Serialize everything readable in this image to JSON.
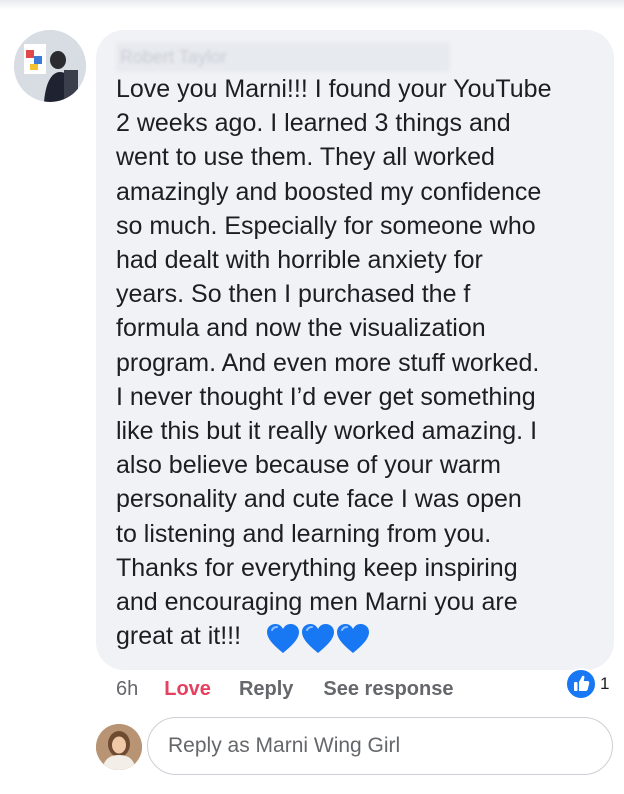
{
  "comment": {
    "author_name": "Robert Taylor",
    "text": "Love you Marni!!! I found your YouTube\n2 weeks ago. I learned 3 things and\nwent to use them. They all worked\namazingly and boosted my confidence\nso much. Especially for someone who\nhad dealt with horrible anxiety for\nyears. So then I purchased the f\nformula and now the visualization\nprogram. And even more stuff worked.\nI never thought I’d ever get something\nlike this but it really worked amazing. I\nalso believe because of your warm\npersonality and cute face I was open\nto listening and learning from you.\nThanks for everything keep inspiring\nand encouraging men Marni you are\ngreat at it!!!",
    "emoji": [
      "blue-heart-icon",
      "blue-heart-icon",
      "blue-heart-icon"
    ],
    "reaction_count": "1"
  },
  "actions": {
    "time": "6h",
    "love": "Love",
    "reply": "Reply",
    "see_response": "See response"
  },
  "reply_box": {
    "placeholder": "Reply as Marni Wing Girl"
  },
  "colors": {
    "bubble": "#f0f2f5",
    "love": "#e4405f",
    "heart": "#1877f2",
    "secondary_text": "#65676b"
  }
}
